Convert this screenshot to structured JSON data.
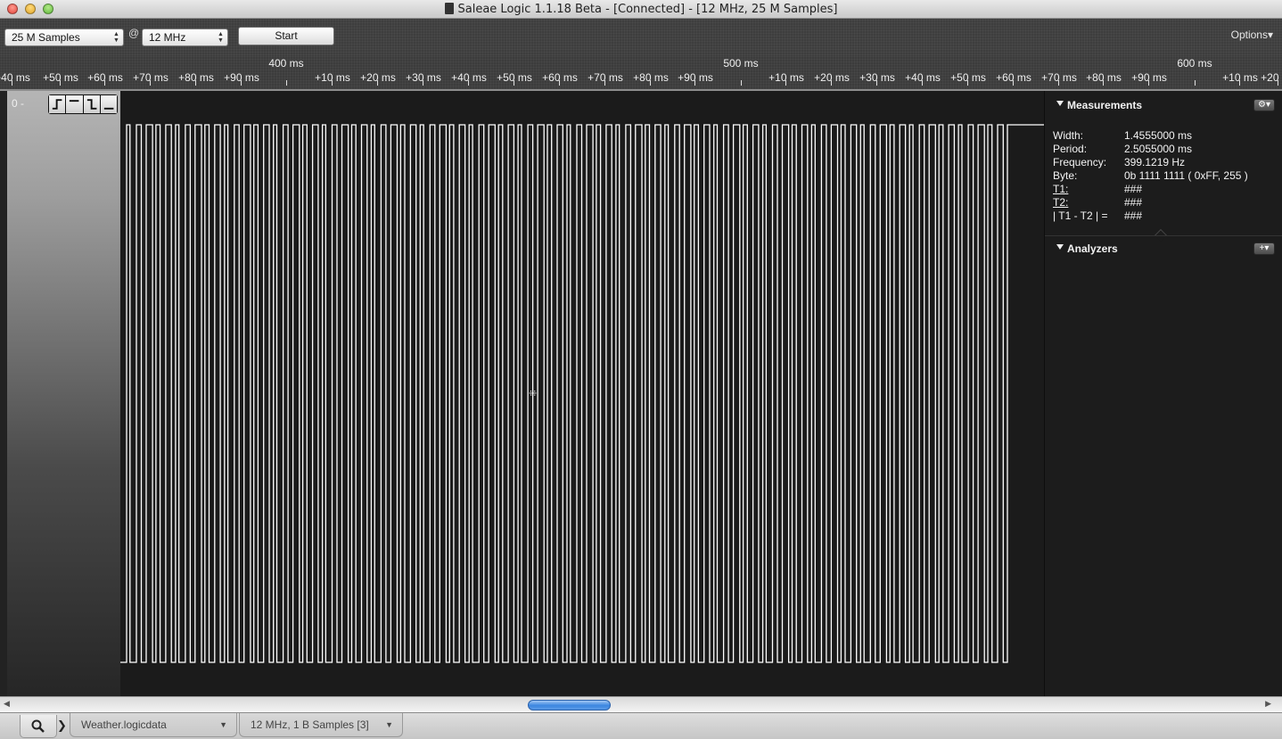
{
  "window": {
    "title": "Saleae Logic 1.1.18 Beta - [Connected] - [12 MHz, 25 M Samples]"
  },
  "toolbar": {
    "samples_value": "25 M Samples",
    "at_symbol": "@",
    "rate_value": "12 MHz",
    "start_label": "Start",
    "options_label": "Options▾"
  },
  "ruler": {
    "minor_labels": [
      "+40 ms",
      "+50 ms",
      "+60 ms",
      "+70 ms",
      "+80 ms",
      "+90 ms",
      "+10 ms",
      "+20 ms",
      "+30 ms",
      "+40 ms",
      "+50 ms",
      "+60 ms",
      "+70 ms",
      "+80 ms",
      "+90 ms",
      "+10 ms",
      "+20 ms",
      "+30 ms",
      "+40 ms",
      "+50 ms",
      "+60 ms",
      "+70 ms",
      "+80 ms",
      "+90 ms",
      "+10 ms",
      "+20 ms"
    ],
    "major_labels": [
      "400 ms",
      "500 ms",
      "600 ms"
    ]
  },
  "channel": {
    "label": "0 -",
    "trigger_buttons": [
      "rising-edge-trigger",
      "high-level-trigger",
      "falling-edge-trigger",
      "low-level-trigger"
    ]
  },
  "waveform": {
    "pulse_count": 90,
    "colors": {
      "signal": "#ffffff",
      "background": "#1b1b1b"
    }
  },
  "measurements": {
    "header": "Measurements",
    "gear_icon": "gear-icon",
    "rows": [
      {
        "key": "Width:",
        "value": "1.4555000 ms"
      },
      {
        "key": "Period:",
        "value": "2.5055000 ms"
      },
      {
        "key": "Frequency:",
        "value": "399.1219 Hz"
      },
      {
        "key": "Byte:",
        "value": "0b  1111  1111 ( 0xFF, 255 )"
      },
      {
        "key": "T1:",
        "value": "###"
      },
      {
        "key": "T2:",
        "value": "###"
      },
      {
        "key": "| T1 - T2 | =",
        "value": "###"
      }
    ]
  },
  "analyzers": {
    "header": "Analyzers",
    "add_button": "+▾"
  },
  "tabs": {
    "file1": "Weather.logicdata",
    "file2": "12 MHz, 1 B Samples [3]"
  }
}
